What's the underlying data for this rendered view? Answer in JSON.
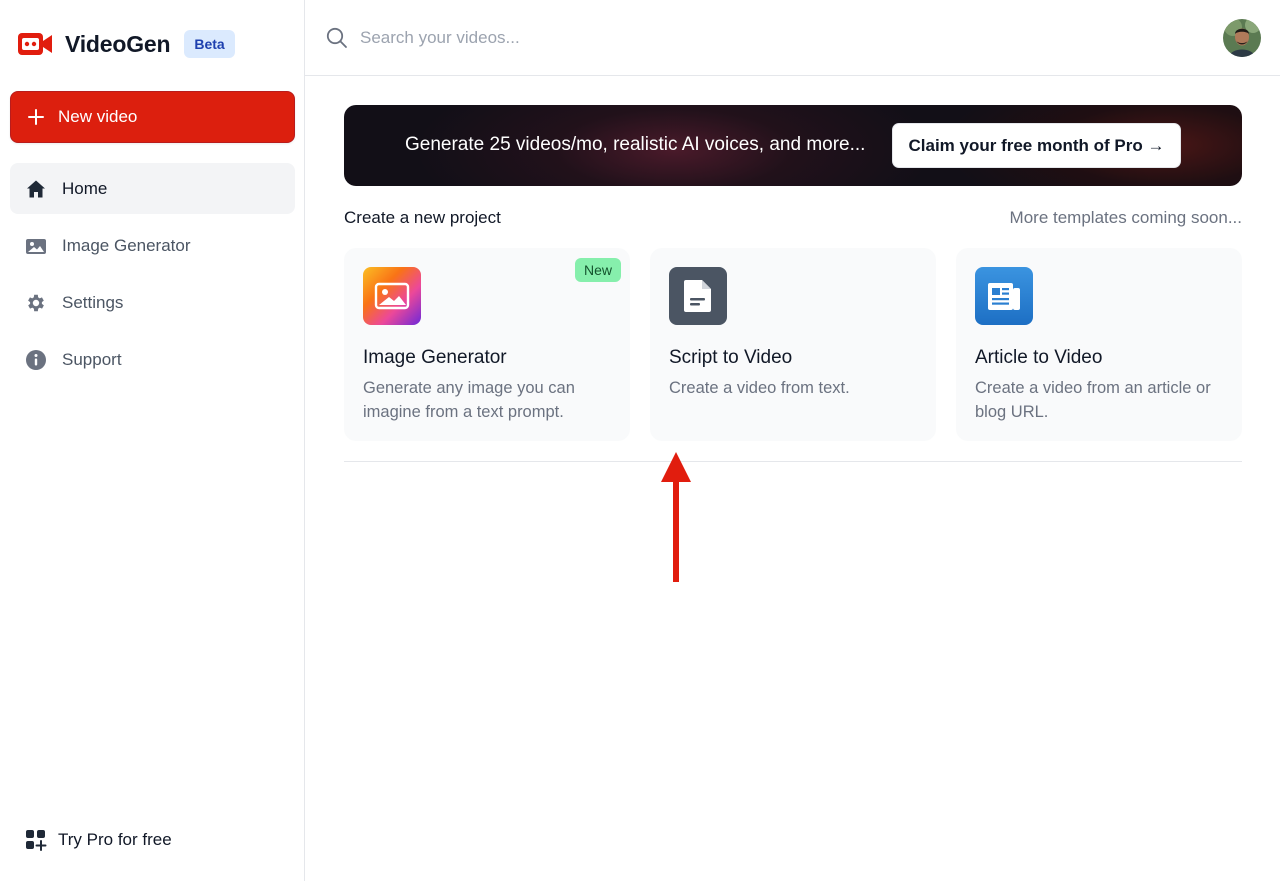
{
  "sidebar": {
    "brand": {
      "name": "VideoGen",
      "badge": "Beta"
    },
    "new_video_label": "New video",
    "items": [
      {
        "label": "Home",
        "icon": "home-icon",
        "active": true
      },
      {
        "label": "Image Generator",
        "icon": "image-icon",
        "active": false
      },
      {
        "label": "Settings",
        "icon": "gear-icon",
        "active": false
      },
      {
        "label": "Support",
        "icon": "info-icon",
        "active": false
      }
    ],
    "try_pro_label": "Try Pro for free"
  },
  "header": {
    "search": {
      "placeholder": "Search your videos...",
      "value": ""
    }
  },
  "banner": {
    "text": "Generate 25 videos/mo, realistic AI voices, and more...",
    "button_label": "Claim your free month of Pro →"
  },
  "main": {
    "section_title": "Create a new project",
    "section_note": "More templates coming soon...",
    "cards": [
      {
        "title": "Image Generator",
        "description": "Generate any image you can imagine from a text prompt.",
        "badge": "New",
        "icon": "gradient-image-icon"
      },
      {
        "title": "Script to Video",
        "description": "Create a video from text.",
        "icon": "document-icon"
      },
      {
        "title": "Article to Video",
        "description": "Create a video from an article or blog URL.",
        "icon": "newspaper-icon"
      }
    ]
  },
  "colors": {
    "brand_red": "#dc1f0e",
    "beta_bg": "#dbeafe",
    "new_badge": "#86efac",
    "arrow": "#e11d0e"
  }
}
